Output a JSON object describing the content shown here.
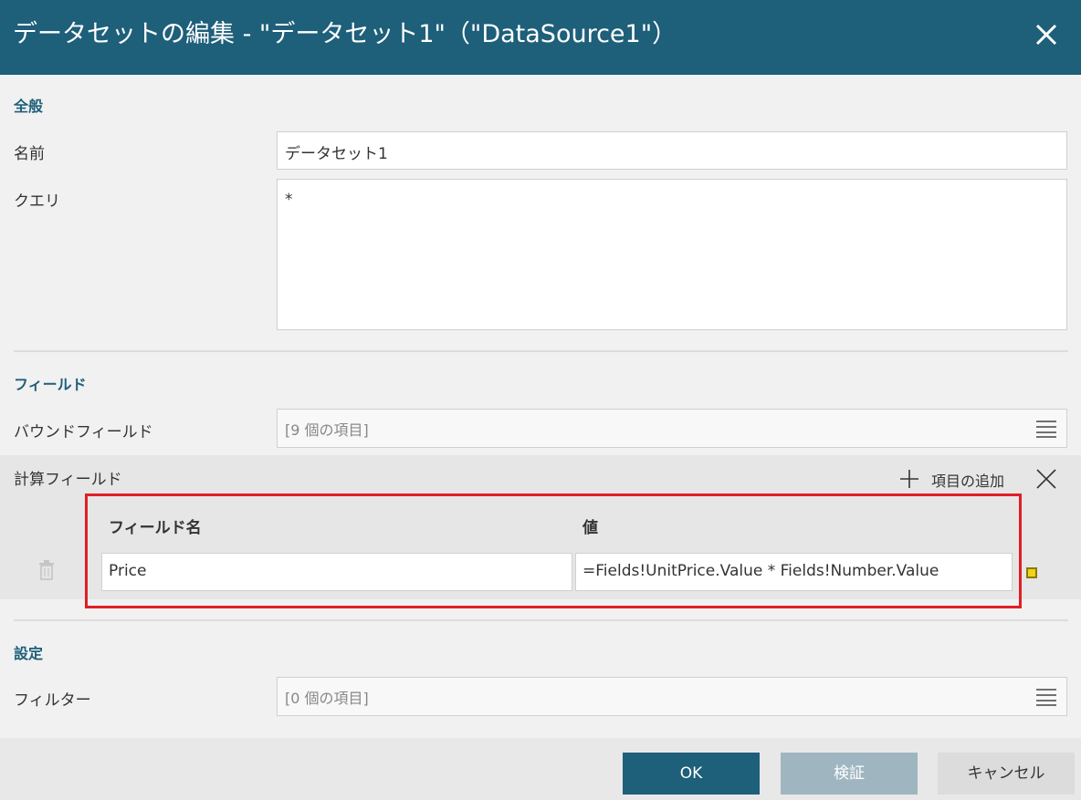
{
  "dialog": {
    "title": "データセットの編集 - \"データセット1\"（\"DataSource1\"）"
  },
  "general": {
    "section_title": "全般",
    "name_label": "名前",
    "name_value": "データセット1",
    "query_label": "クエリ",
    "query_value": "*"
  },
  "fields": {
    "section_title": "フィールド",
    "bound_label": "バウンドフィールド",
    "bound_summary": "[9 個の項目]",
    "calc_label": "計算フィールド",
    "add_item_label": "項目の追加",
    "table": {
      "header_name": "フィールド名",
      "header_value": "値",
      "rows": [
        {
          "name": "Price",
          "value": "=Fields!UnitPrice.Value * Fields!Number.Value"
        }
      ]
    }
  },
  "settings": {
    "section_title": "設定",
    "filter_label": "フィルター",
    "filter_summary": "[0 個の項目]"
  },
  "buttons": {
    "ok": "OK",
    "validate": "検証",
    "cancel": "キャンセル"
  },
  "colors": {
    "header_bg": "#1e5f7a",
    "highlight_frame": "#e01e25",
    "expression_marker": "#f2d21a"
  }
}
